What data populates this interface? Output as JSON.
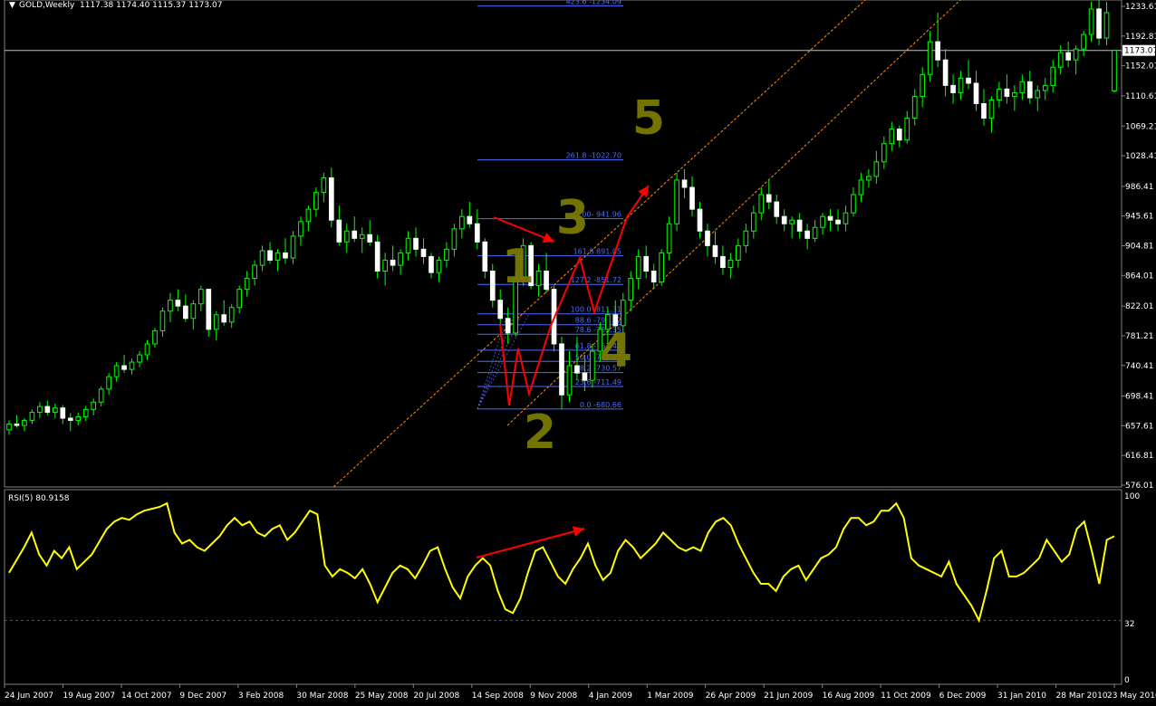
{
  "header": {
    "symbol": "GOLD,Weekly",
    "ohlc": "1117.38 1174.40 1115.37 1173.07"
  },
  "rsi_panel": {
    "label": "RSI(5) 80.9158",
    "levels": [
      "100",
      "32",
      "0"
    ]
  },
  "price_axis": {
    "ticks": [
      "1233.61",
      "1192.81",
      "1152.01",
      "1110.61",
      "1069.21",
      "1028.41",
      "986.41",
      "945.61",
      "904.81",
      "864.01",
      "822.01",
      "781.21",
      "740.41",
      "698.41",
      "657.61",
      "616.81",
      "576.01"
    ],
    "current": "1173.07"
  },
  "time_axis": {
    "ticks": [
      "24 Jun 2007",
      "19 Aug 2007",
      "14 Oct 2007",
      "9 Dec 2007",
      "3 Feb 2008",
      "30 Mar 2008",
      "25 May 2008",
      "20 Jul 2008",
      "14 Sep 2008",
      "9 Nov 2008",
      "4 Jan 2009",
      "1 Mar 2009",
      "26 Apr 2009",
      "21 Jun 2009",
      "16 Aug 2009",
      "11 Oct 2009",
      "6 Dec 2009",
      "31 Jan 2010",
      "28 Mar 2010",
      "23 May 2010"
    ]
  },
  "fibonacci": {
    "levels": [
      {
        "label": "423.6 -1234.09",
        "price": 1234.09
      },
      {
        "label": "261.8 -1022.70",
        "price": 1022.7
      },
      {
        "label": "200- 941.96",
        "price": 941.96
      },
      {
        "label": "161.8 891.05",
        "price": 891.05
      },
      {
        "label": "127.2 -851.72",
        "price": 851.72
      },
      {
        "label": "100.0 -811.31",
        "price": 811.31
      },
      {
        "label": "88.6 -796.42",
        "price": 796.42
      },
      {
        "label": "78.6 -783.35",
        "price": 783.35
      },
      {
        "label": "61.8 -761.40",
        "price": 761.4
      },
      {
        "label": "50.0 -745.93",
        "price": 745.93
      },
      {
        "label": "38.2 -730.57",
        "price": 730.57
      },
      {
        "label": "23.6 -711.49",
        "price": 711.49
      },
      {
        "label": "0.0 -680.66",
        "price": 680.66
      }
    ]
  },
  "wave_labels": [
    "1",
    "2",
    "3",
    "4",
    "5"
  ],
  "colors": {
    "bull": "#00ff00",
    "bear": "#ffffff",
    "wick": "#00ff00",
    "rsi": "#ffff00",
    "fib": "#4a6cff",
    "channel": "#ff8c00",
    "arrow": "#ff0000",
    "wave_label": "#7a7a00",
    "axis_text": "#ffffff"
  },
  "chart_data": {
    "type": "candlestick",
    "price_range": [
      576.01,
      1250
    ],
    "rsi_range": [
      0,
      100
    ],
    "rsi_level": 32,
    "grid": false,
    "candles": [
      [
        652,
        665,
        645,
        660
      ],
      [
        660,
        672,
        655,
        658
      ],
      [
        658,
        668,
        650,
        665
      ],
      [
        665,
        680,
        660,
        676
      ],
      [
        676,
        690,
        668,
        684
      ],
      [
        684,
        692,
        672,
        676
      ],
      [
        676,
        688,
        668,
        682
      ],
      [
        682,
        686,
        660,
        668
      ],
      [
        668,
        675,
        650,
        665
      ],
      [
        665,
        676,
        658,
        670
      ],
      [
        670,
        685,
        664,
        680
      ],
      [
        680,
        695,
        672,
        690
      ],
      [
        690,
        712,
        684,
        708
      ],
      [
        708,
        730,
        700,
        725
      ],
      [
        725,
        745,
        718,
        740
      ],
      [
        740,
        755,
        730,
        735
      ],
      [
        735,
        750,
        728,
        745
      ],
      [
        745,
        760,
        738,
        755
      ],
      [
        755,
        775,
        748,
        770
      ],
      [
        770,
        792,
        765,
        788
      ],
      [
        788,
        820,
        780,
        815
      ],
      [
        815,
        840,
        800,
        830
      ],
      [
        830,
        845,
        815,
        822
      ],
      [
        822,
        838,
        800,
        805
      ],
      [
        805,
        830,
        790,
        825
      ],
      [
        825,
        850,
        815,
        845
      ],
      [
        845,
        838,
        780,
        790
      ],
      [
        790,
        815,
        775,
        810
      ],
      [
        810,
        830,
        795,
        800
      ],
      [
        800,
        825,
        792,
        820
      ],
      [
        820,
        850,
        812,
        845
      ],
      [
        845,
        870,
        835,
        860
      ],
      [
        860,
        885,
        850,
        878
      ],
      [
        878,
        905,
        870,
        898
      ],
      [
        898,
        910,
        880,
        885
      ],
      [
        885,
        900,
        870,
        895
      ],
      [
        895,
        915,
        880,
        888
      ],
      [
        888,
        925,
        880,
        918
      ],
      [
        918,
        945,
        905,
        938
      ],
      [
        938,
        960,
        925,
        955
      ],
      [
        955,
        985,
        945,
        978
      ],
      [
        978,
        1005,
        965,
        998
      ],
      [
        998,
        1012,
        930,
        940
      ],
      [
        940,
        960,
        905,
        910
      ],
      [
        910,
        935,
        895,
        925
      ],
      [
        925,
        945,
        910,
        915
      ],
      [
        915,
        930,
        895,
        920
      ],
      [
        920,
        940,
        905,
        910
      ],
      [
        910,
        920,
        860,
        870
      ],
      [
        870,
        895,
        850,
        885
      ],
      [
        885,
        905,
        870,
        878
      ],
      [
        878,
        900,
        865,
        895
      ],
      [
        895,
        925,
        885,
        915
      ],
      [
        915,
        930,
        890,
        900
      ],
      [
        900,
        915,
        880,
        890
      ],
      [
        890,
        895,
        860,
        868
      ],
      [
        868,
        890,
        855,
        885
      ],
      [
        885,
        910,
        875,
        900
      ],
      [
        900,
        935,
        890,
        928
      ],
      [
        928,
        955,
        915,
        945
      ],
      [
        945,
        965,
        930,
        935
      ],
      [
        935,
        955,
        900,
        910
      ],
      [
        910,
        915,
        860,
        870
      ],
      [
        870,
        880,
        820,
        830
      ],
      [
        830,
        845,
        795,
        805
      ],
      [
        805,
        820,
        770,
        785
      ],
      [
        785,
        870,
        780,
        860
      ],
      [
        860,
        915,
        850,
        905
      ],
      [
        905,
        910,
        845,
        850
      ],
      [
        850,
        880,
        835,
        870
      ],
      [
        870,
        895,
        840,
        845
      ],
      [
        845,
        850,
        760,
        770
      ],
      [
        770,
        780,
        680,
        700
      ],
      [
        700,
        760,
        690,
        740
      ],
      [
        740,
        780,
        720,
        730
      ],
      [
        730,
        755,
        705,
        720
      ],
      [
        720,
        770,
        710,
        760
      ],
      [
        760,
        800,
        745,
        790
      ],
      [
        790,
        820,
        770,
        810
      ],
      [
        810,
        830,
        780,
        795
      ],
      [
        795,
        840,
        785,
        830
      ],
      [
        830,
        870,
        815,
        860
      ],
      [
        860,
        900,
        845,
        890
      ],
      [
        890,
        905,
        860,
        870
      ],
      [
        870,
        880,
        845,
        855
      ],
      [
        855,
        900,
        850,
        895
      ],
      [
        895,
        945,
        885,
        935
      ],
      [
        935,
        1005,
        925,
        995
      ],
      [
        995,
        1010,
        970,
        985
      ],
      [
        985,
        1000,
        945,
        955
      ],
      [
        955,
        965,
        915,
        925
      ],
      [
        925,
        935,
        890,
        905
      ],
      [
        905,
        925,
        880,
        890
      ],
      [
        890,
        905,
        865,
        875
      ],
      [
        875,
        895,
        860,
        885
      ],
      [
        885,
        915,
        875,
        905
      ],
      [
        905,
        935,
        895,
        925
      ],
      [
        925,
        960,
        915,
        950
      ],
      [
        950,
        985,
        940,
        975
      ],
      [
        975,
        995,
        955,
        965
      ],
      [
        965,
        975,
        935,
        945
      ],
      [
        945,
        955,
        925,
        935
      ],
      [
        935,
        945,
        915,
        940
      ],
      [
        940,
        950,
        915,
        925
      ],
      [
        925,
        935,
        900,
        915
      ],
      [
        915,
        940,
        910,
        930
      ],
      [
        930,
        950,
        920,
        945
      ],
      [
        945,
        955,
        925,
        940
      ],
      [
        940,
        955,
        925,
        935
      ],
      [
        935,
        960,
        925,
        950
      ],
      [
        950,
        985,
        945,
        975
      ],
      [
        975,
        1005,
        965,
        995
      ],
      [
        995,
        1010,
        985,
        1000
      ],
      [
        1000,
        1035,
        990,
        1020
      ],
      [
        1020,
        1055,
        1010,
        1045
      ],
      [
        1045,
        1075,
        1035,
        1065
      ],
      [
        1065,
        1070,
        1040,
        1050
      ],
      [
        1050,
        1090,
        1045,
        1080
      ],
      [
        1080,
        1120,
        1070,
        1110
      ],
      [
        1110,
        1150,
        1095,
        1140
      ],
      [
        1140,
        1200,
        1130,
        1185
      ],
      [
        1185,
        1225,
        1150,
        1160
      ],
      [
        1160,
        1175,
        1110,
        1125
      ],
      [
        1125,
        1140,
        1100,
        1115
      ],
      [
        1115,
        1145,
        1105,
        1135
      ],
      [
        1135,
        1160,
        1120,
        1128
      ],
      [
        1128,
        1145,
        1090,
        1100
      ],
      [
        1100,
        1120,
        1070,
        1080
      ],
      [
        1080,
        1110,
        1060,
        1105
      ],
      [
        1105,
        1130,
        1095,
        1120
      ],
      [
        1120,
        1140,
        1100,
        1110
      ],
      [
        1110,
        1125,
        1090,
        1115
      ],
      [
        1115,
        1140,
        1105,
        1130
      ],
      [
        1130,
        1145,
        1100,
        1108
      ],
      [
        1108,
        1125,
        1090,
        1118
      ],
      [
        1118,
        1135,
        1105,
        1125
      ],
      [
        1125,
        1160,
        1115,
        1150
      ],
      [
        1150,
        1180,
        1140,
        1170
      ],
      [
        1170,
        1185,
        1150,
        1160
      ],
      [
        1160,
        1180,
        1140,
        1175
      ],
      [
        1175,
        1200,
        1165,
        1195
      ],
      [
        1195,
        1240,
        1185,
        1230
      ],
      [
        1230,
        1248,
        1180,
        1190
      ],
      [
        1190,
        1240,
        1180,
        1225
      ],
      [
        1117.38,
        1174.4,
        1115.37,
        1173.07
      ]
    ],
    "rsi": [
      58,
      65,
      72,
      80,
      68,
      62,
      70,
      66,
      72,
      60,
      64,
      68,
      75,
      82,
      86,
      88,
      87,
      90,
      92,
      93,
      94,
      96,
      80,
      74,
      76,
      72,
      70,
      74,
      78,
      84,
      88,
      84,
      86,
      80,
      78,
      82,
      84,
      76,
      80,
      86,
      92,
      90,
      62,
      56,
      60,
      58,
      55,
      60,
      52,
      42,
      50,
      58,
      62,
      60,
      55,
      62,
      70,
      72,
      60,
      50,
      44,
      56,
      62,
      66,
      62,
      48,
      38,
      36,
      44,
      58,
      70,
      72,
      64,
      56,
      52,
      60,
      66,
      74,
      62,
      54,
      58,
      70,
      76,
      72,
      66,
      70,
      74,
      80,
      76,
      72,
      70,
      72,
      70,
      80,
      86,
      88,
      84,
      74,
      66,
      58,
      52,
      52,
      48,
      56,
      60,
      62,
      54,
      60,
      66,
      68,
      72,
      82,
      88,
      88,
      84,
      86,
      92,
      92,
      96,
      88,
      66,
      62,
      60,
      58,
      56,
      64,
      52,
      46,
      40,
      32,
      48,
      66,
      70,
      56,
      56,
      58,
      62,
      66,
      76,
      70,
      64,
      68,
      82,
      86,
      70,
      52,
      76,
      78
    ]
  }
}
